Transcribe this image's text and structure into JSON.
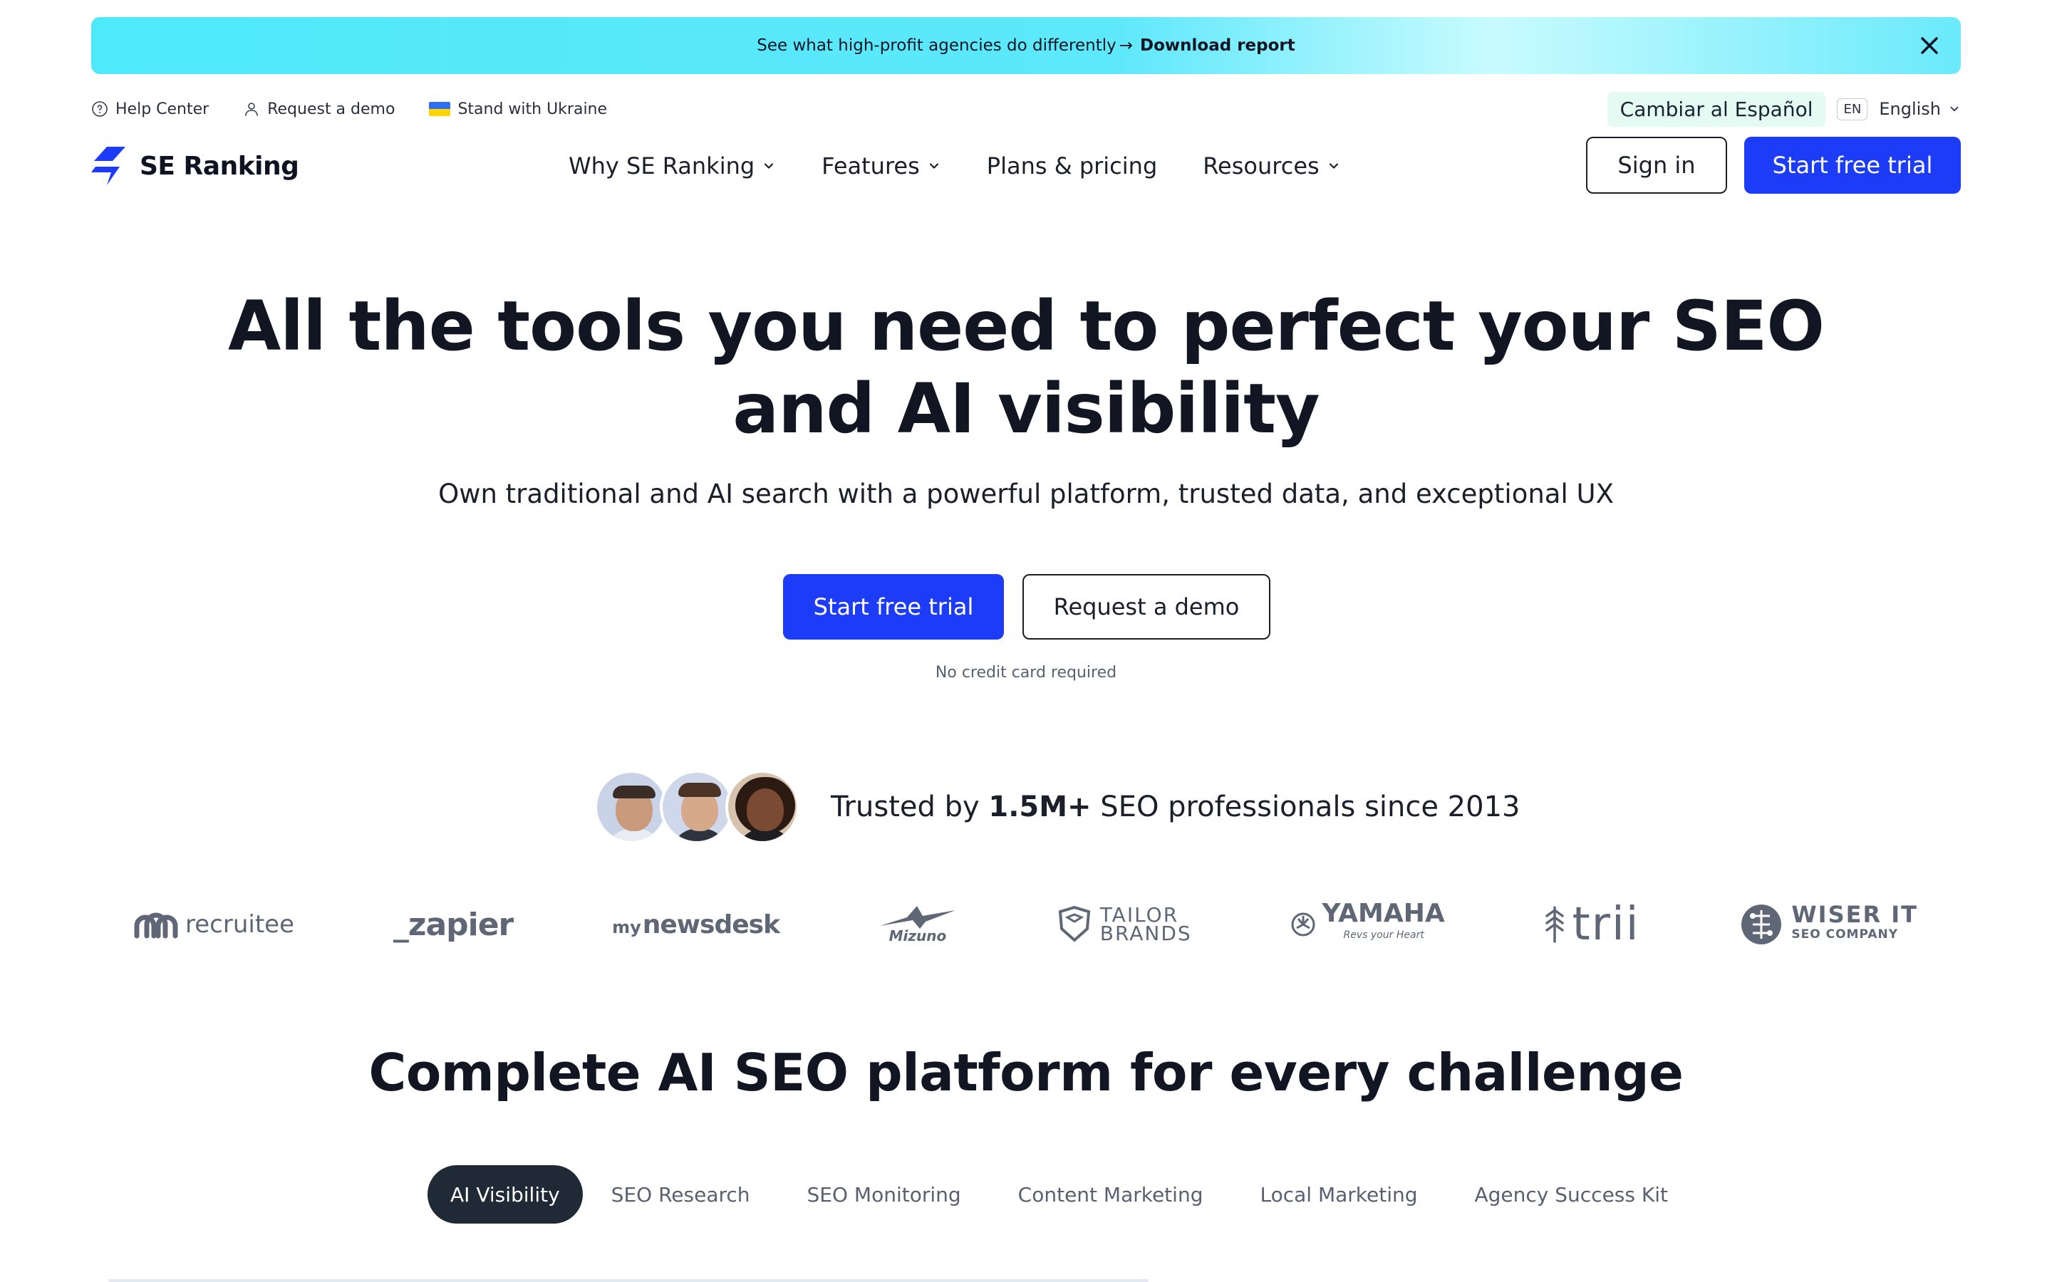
{
  "banner": {
    "text": "See what high-profit agencies do differently",
    "arrow": "→",
    "link": "Download report",
    "close_icon": "close-icon",
    "colors": {
      "start": "#4ee9fb",
      "end": "#c8fbff"
    }
  },
  "utility": {
    "help": "Help Center",
    "demo": "Request a demo",
    "ukraine": "Stand with Ukraine"
  },
  "language": {
    "switch": "Cambiar al Español",
    "code": "EN",
    "current": "English"
  },
  "brand": {
    "name": "SE Ranking",
    "accent": "#1d3cf7"
  },
  "nav": {
    "why": "Why SE Ranking",
    "features": "Features",
    "pricing": "Plans & pricing",
    "resources": "Resources"
  },
  "header_buttons": {
    "signin": "Sign in",
    "trial": "Start free trial"
  },
  "hero": {
    "title_line1": "All the tools you need to perfect your SEO",
    "title_line2": "and AI visibility",
    "subtitle": "Own traditional and AI search with a powerful platform, trusted data, and exceptional UX",
    "primary_cta": "Start free trial",
    "secondary_cta": "Request a demo",
    "note": "No credit card required"
  },
  "trusted": {
    "prefix": "Trusted by",
    "count": "1.5M+",
    "suffix": "SEO professionals since 2013"
  },
  "logos": {
    "recruitee": "recruitee",
    "zapier": "_zapier",
    "mynewsdesk_my": "my",
    "mynewsdesk_main": "newsdesk",
    "mizuno": "Mizuno",
    "tailor_1": "TAILOR",
    "tailor_2": "BRANDS",
    "yamaha": "YAMAHA",
    "yamaha_tag": "Revs your Heart",
    "trii": "trii",
    "wiser_1": "WISER IT",
    "wiser_2": "SEO COMPANY"
  },
  "section": {
    "title": "Complete AI SEO platform for every challenge",
    "tabs": [
      "AI Visibility",
      "SEO Research",
      "SEO Monitoring",
      "Content Marketing",
      "Local Marketing",
      "Agency Success Kit"
    ],
    "active_tab": "AI Visibility"
  }
}
